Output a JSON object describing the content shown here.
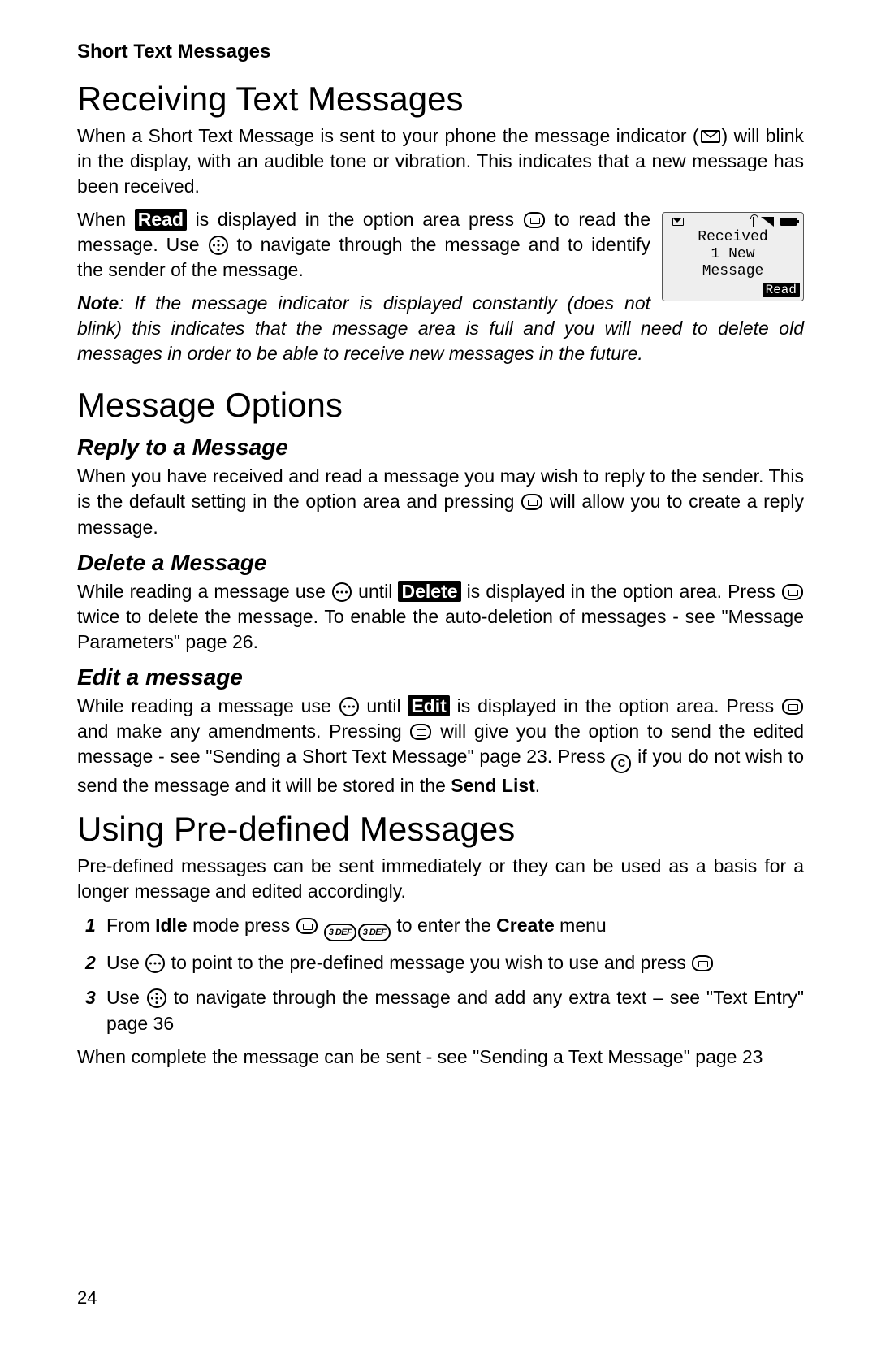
{
  "header": {
    "title": "Short Text Messages"
  },
  "section1": {
    "heading": "Receiving Text Messages",
    "p1a": "When a Short Text Message is sent to your phone the message indicator (",
    "p1b": ") will blink in the display, with an audible tone or vibration. This indicates that a new message has been received.",
    "p2a": "When ",
    "read_chip": "Read",
    "p2b": " is displayed in the option area press ",
    "p2c": " to read the message. Use ",
    "p2d": " to navigate through the message and to identify the sender of the message.",
    "note_label": "Note",
    "note_body": ": If the message indicator is displayed constantly (does not blink) this indicates that the message area is full and you will need to delete old messages in order to be able to receive new messages in the future."
  },
  "phone": {
    "line1": "Received",
    "line2": "1 New",
    "line3": "Message",
    "softkey": "Read"
  },
  "section2": {
    "heading": "Message Options",
    "reply": {
      "heading": "Reply to a Message",
      "p_a": "When you have received and read a message you may wish to reply to the sender. This is the default setting in the option area and pressing ",
      "p_b": " will allow you to create a reply message."
    },
    "delete": {
      "heading": "Delete a Message",
      "p_a": "While reading a message use ",
      "p_b": " until ",
      "chip": "Delete",
      "p_c": " is displayed in the option area. Press ",
      "p_d": " twice to delete the message. To enable the auto-deletion of messages - see \"Message Parameters\" page 26."
    },
    "edit": {
      "heading": "Edit a message",
      "p_a": "While reading a message use ",
      "p_b": " until ",
      "chip": "Edit",
      "p_c": " is displayed in the option area. Press ",
      "p_d": " and make any amendments. Pressing ",
      "p_e": " will give you the option to send the edited message - see \"Sending a Short Text Message\" page 23. Press ",
      "p_f": " if you do not wish to send the message and it will be stored in the ",
      "sendlist": "Send List",
      "p_g": "."
    }
  },
  "section3": {
    "heading": "Using Pre-defined Messages",
    "intro": "Pre-defined messages can be sent immediately or they can be used as a basis for a longer message and edited accordingly.",
    "list": [
      {
        "num": "1",
        "a": "From ",
        "idle": "Idle",
        "b": " mode press ",
        "c": " to enter the ",
        "create": "Create",
        "d": " menu"
      },
      {
        "num": "2",
        "a": "Use ",
        "b": " to point to the pre-defined message you wish to use and press "
      },
      {
        "num": "3",
        "a": "Use ",
        "b": " to navigate through the message and add any extra text – see \"Text Entry\" page 36"
      }
    ],
    "closing": "When complete the message can be sent - see \"Sending a Text Message\" page 23"
  },
  "page_number": "24",
  "icons": {
    "c_key": "C",
    "key3": "3 DEF"
  }
}
